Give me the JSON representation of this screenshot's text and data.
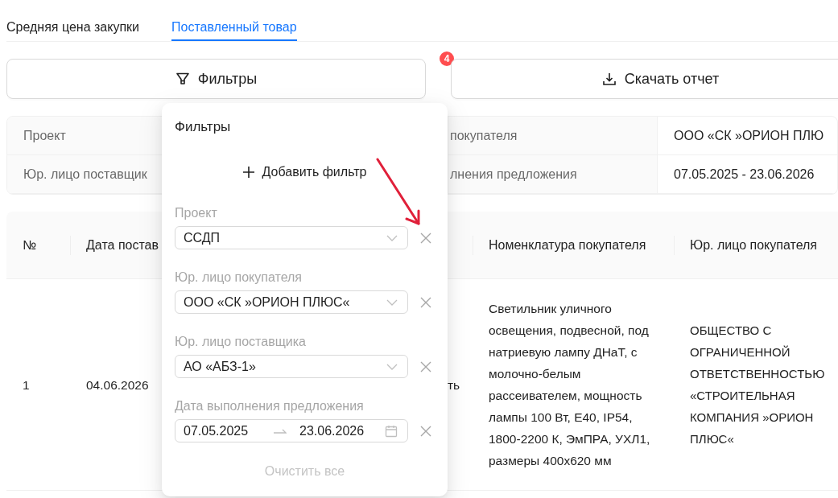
{
  "tabs": [
    {
      "label": "Средняя цена закупки",
      "selected": false
    },
    {
      "label": "Поставленный товар",
      "selected": true
    }
  ],
  "toolbar": {
    "filters_button": {
      "label": "Фильтры",
      "badge": "4"
    },
    "download_button": {
      "label": "Скачать отчет"
    }
  },
  "summary": {
    "rows": [
      {
        "label": "Проект",
        "label_2": "покупателя",
        "value_2": "ООО «СК »ОРИОН ПЛЮ"
      },
      {
        "label": "Юр. лицо поставщик",
        "label_2": "лнения предложения",
        "value_2": "07.05.2025 - 23.06.2026"
      }
    ]
  },
  "table": {
    "columns": {
      "number": "№",
      "date": "Дата постав",
      "nomenclature": "Номенклатура покупателя",
      "buyer": "Юр. лицо покупателя"
    },
    "rows": [
      {
        "number": "1",
        "date": "04.06.2026",
        "column_3": "ть",
        "nomenclature": "Светильник уличного освещения, подвесной, под натриевую лампу ДНаТ, с молочно-белым рассеивателем, мощность лампы 100 Вт, Е40, IP54, 1800-2200 К, ЭмПРА, УХЛ1, размеры 400х620 мм",
        "buyer": "ОБЩЕСТВО С ОГРАНИЧЕННОЙ ОТВЕТСТВЕННОСТЬЮ «СТРОИТЕЛЬНАЯ КОМПАНИЯ »ОРИОН ПЛЮС«"
      }
    ]
  },
  "filter_popover": {
    "title": "Фильтры",
    "add_button": "Добавить фильтр",
    "filters": [
      {
        "kind": "select",
        "label": "Проект",
        "value": "ССДП"
      },
      {
        "kind": "select",
        "label": "Юр. лицо покупателя",
        "value": "ООО «СК »ОРИОН ПЛЮС«"
      },
      {
        "kind": "select",
        "label": "Юр. лицо поставщика",
        "value": "АО «АБЗ-1»"
      },
      {
        "kind": "date_range",
        "label": "Дата выполнения предложения",
        "from": "07.05.2025",
        "to": "23.06.2026"
      }
    ],
    "clear_button": {
      "label": "Очистить все",
      "disabled": true
    }
  }
}
